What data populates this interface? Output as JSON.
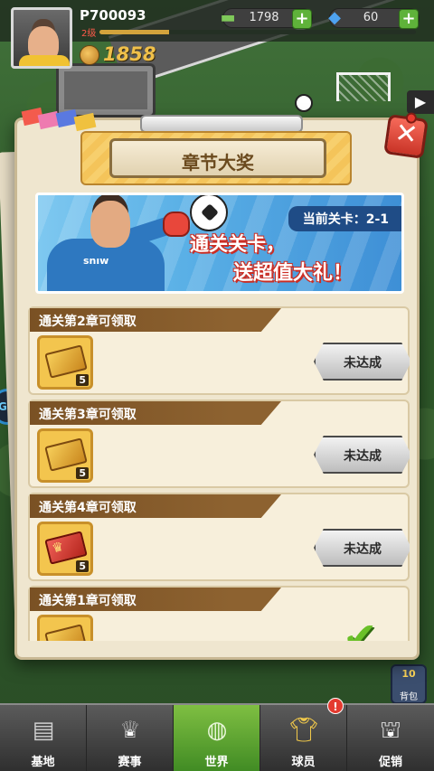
{
  "player": {
    "id": "P700093",
    "level": "2级",
    "xp_fraction": 0.22,
    "cash": "1798",
    "gems": "60",
    "coins": "1858"
  },
  "modal": {
    "title": "章节大奖",
    "close_icon": "close-x",
    "banner": {
      "stage": "当前关卡：2-1",
      "line1": "通关关卡，",
      "line2": "送超值大礼！",
      "jersey_text": "snıw"
    },
    "rewards": [
      {
        "title": "通关第2章可领取",
        "count": "5",
        "item_icon": "gold-ticket",
        "status": "未达成"
      },
      {
        "title": "通关第3章可领取",
        "count": "5",
        "item_icon": "gold-ticket",
        "status": "未达成"
      },
      {
        "title": "通关第4章可领取",
        "count": "5",
        "item_icon": "red-trophy-ticket",
        "status": "未达成"
      },
      {
        "title": "通关第1章可领取",
        "count": "",
        "item_icon": "gold-ticket",
        "status_icon": "check-icon"
      }
    ]
  },
  "side": {
    "bag_count": "10",
    "bag_label": "背包"
  },
  "nav": {
    "items": [
      {
        "label": "基地",
        "icon": "base-icon",
        "locked": false
      },
      {
        "label": "赛事",
        "icon": "trophy-icon",
        "locked": true
      },
      {
        "label": "世界",
        "icon": "globe-icon",
        "active": true
      },
      {
        "label": "球员",
        "icon": "jersey-icon",
        "alert": "!"
      },
      {
        "label": "促销",
        "icon": "shop-icon",
        "locked": true
      }
    ]
  },
  "colors": {
    "accent_green": "#5fb23a",
    "banner_gold": "#f4c45a",
    "header_brown": "#7a5124",
    "close_red": "#e8473b"
  }
}
